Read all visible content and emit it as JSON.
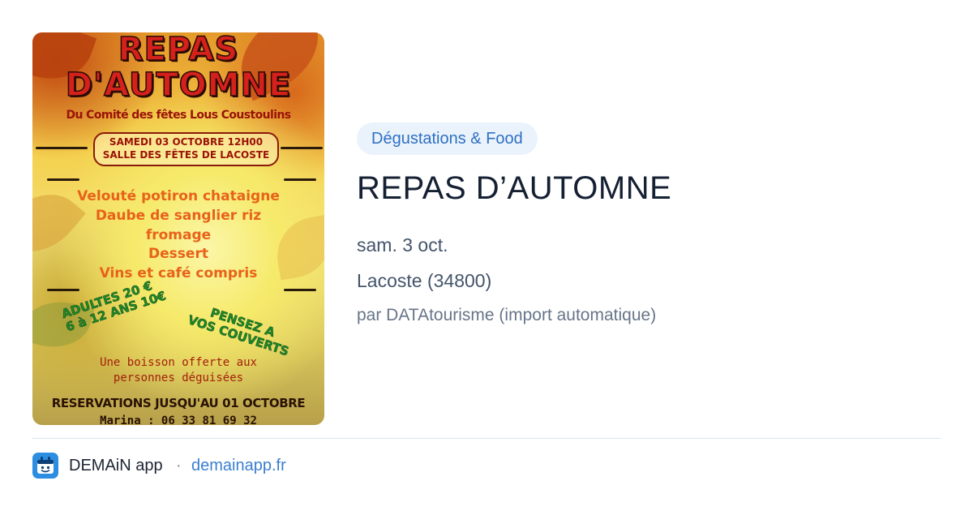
{
  "poster": {
    "title_line1": "REPAS",
    "title_line2": "D'AUTOMNE",
    "organizer": "Du Comité des fêtes Lous Coustoulins",
    "banner_line1": "SAMEDI 03 OCTOBRE 12H00",
    "banner_line2": "SALLE DES FÊTES DE LACOSTE",
    "menu": [
      "Velouté potiron chataigne",
      "Daube de sanglier riz",
      "fromage",
      "Dessert",
      "Vins et café compris"
    ],
    "price_line1": "ADULTES 20 €",
    "price_line2": "6 à 12 ANS 10€",
    "reminder_line1": "PENSEZ A",
    "reminder_line2": "VOS COUVERTS",
    "offer_line1": "Une boisson offerte aux",
    "offer_line2": "personnes déguisées",
    "reservation": "RESERVATIONS JUSQU'AU 01 OCTOBRE",
    "contact": "Marina : 06 33 81 69 32"
  },
  "event": {
    "category": "Dégustations & Food",
    "title": "REPAS D’AUTOMNE",
    "date": "sam. 3 oct.",
    "location": "Lacoste (34800)",
    "author": "par DATAtourisme (import automatique)"
  },
  "footer": {
    "app_icon": "demain-app-icon",
    "app_name": "DEMAiN app",
    "separator": "·",
    "link": "demainapp.fr"
  },
  "colors": {
    "badge_bg": "#eaf3fc",
    "badge_text": "#2f6fc4",
    "title": "#152033",
    "link": "#3a7fd0",
    "app_icon": "#2c8ee0"
  }
}
